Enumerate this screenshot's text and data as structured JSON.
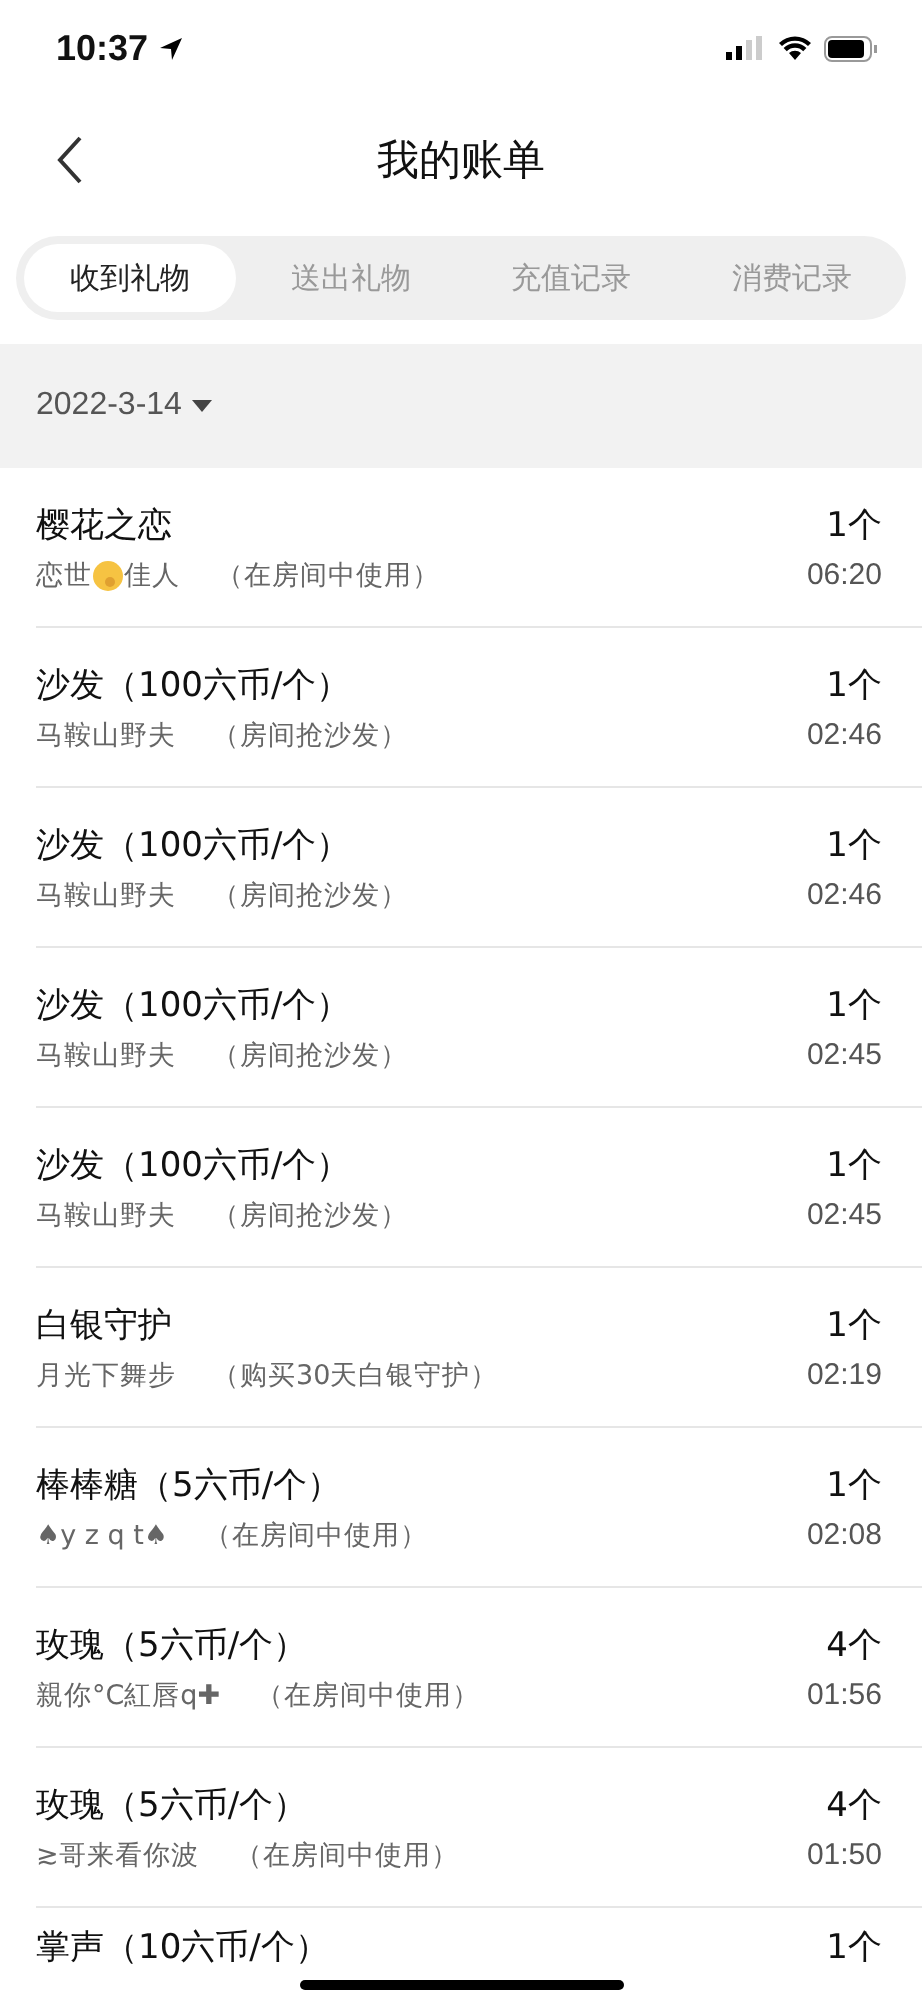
{
  "status_bar": {
    "time": "10:37"
  },
  "nav": {
    "title": "我的账单"
  },
  "tabs": [
    {
      "label": "收到礼物",
      "selected": true
    },
    {
      "label": "送出礼物",
      "selected": false
    },
    {
      "label": "充值记录",
      "selected": false
    },
    {
      "label": "消费记录",
      "selected": false
    }
  ],
  "date_filter": {
    "label": "2022-3-14"
  },
  "records": [
    {
      "gift": "樱花之恋",
      "sender": [
        {
          "kind": "text",
          "text": "恋世"
        },
        {
          "kind": "emoji"
        },
        {
          "kind": "text",
          "text": "佳人"
        }
      ],
      "note": "（在房间中使用）",
      "count": "1个",
      "time": "06:20"
    },
    {
      "gift": "沙发（100六币/个）",
      "sender": [
        {
          "kind": "text",
          "text": "马鞍山野夫"
        }
      ],
      "note": "（房间抢沙发）",
      "count": "1个",
      "time": "02:46"
    },
    {
      "gift": "沙发（100六币/个）",
      "sender": [
        {
          "kind": "text",
          "text": "马鞍山野夫"
        }
      ],
      "note": "（房间抢沙发）",
      "count": "1个",
      "time": "02:46"
    },
    {
      "gift": "沙发（100六币/个）",
      "sender": [
        {
          "kind": "text",
          "text": "马鞍山野夫"
        }
      ],
      "note": "（房间抢沙发）",
      "count": "1个",
      "time": "02:45"
    },
    {
      "gift": "沙发（100六币/个）",
      "sender": [
        {
          "kind": "text",
          "text": "马鞍山野夫"
        }
      ],
      "note": "（房间抢沙发）",
      "count": "1个",
      "time": "02:45"
    },
    {
      "gift": "白银守护",
      "sender": [
        {
          "kind": "text",
          "text": "月光下舞步"
        }
      ],
      "note": "（购买30天白银守护）",
      "count": "1个",
      "time": "02:19"
    },
    {
      "gift": "棒棒糖（5六币/个）",
      "sender": [
        {
          "kind": "text",
          "text": "♠y z q t♠"
        }
      ],
      "note": "（在房间中使用）",
      "count": "1个",
      "time": "02:08"
    },
    {
      "gift": "玫瑰（5六币/个）",
      "sender": [
        {
          "kind": "text",
          "text": "親你°C紅唇q✚"
        }
      ],
      "note": "（在房间中使用）",
      "count": "4个",
      "time": "01:56"
    },
    {
      "gift": "玫瑰（5六币/个）",
      "sender": [
        {
          "kind": "text",
          "text": "≳哥来看你波"
        }
      ],
      "note": "（在房间中使用）",
      "count": "4个",
      "time": "01:50"
    },
    {
      "gift": "掌声（10六币/个）",
      "count": "1个"
    }
  ]
}
